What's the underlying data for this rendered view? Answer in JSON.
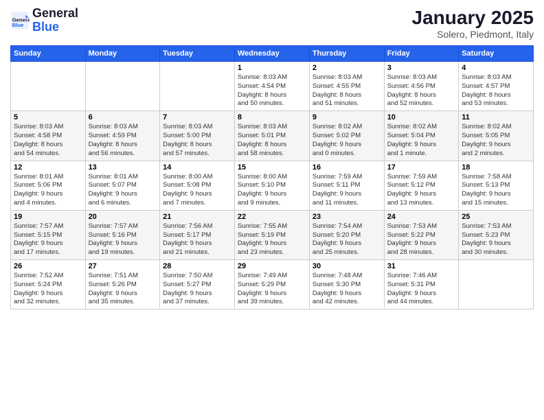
{
  "header": {
    "logo_general": "General",
    "logo_blue": "Blue",
    "month_title": "January 2025",
    "location": "Solero, Piedmont, Italy"
  },
  "weekdays": [
    "Sunday",
    "Monday",
    "Tuesday",
    "Wednesday",
    "Thursday",
    "Friday",
    "Saturday"
  ],
  "weeks": [
    [
      {
        "day": "",
        "info": ""
      },
      {
        "day": "",
        "info": ""
      },
      {
        "day": "",
        "info": ""
      },
      {
        "day": "1",
        "info": "Sunrise: 8:03 AM\nSunset: 4:54 PM\nDaylight: 8 hours\nand 50 minutes."
      },
      {
        "day": "2",
        "info": "Sunrise: 8:03 AM\nSunset: 4:55 PM\nDaylight: 8 hours\nand 51 minutes."
      },
      {
        "day": "3",
        "info": "Sunrise: 8:03 AM\nSunset: 4:56 PM\nDaylight: 8 hours\nand 52 minutes."
      },
      {
        "day": "4",
        "info": "Sunrise: 8:03 AM\nSunset: 4:57 PM\nDaylight: 8 hours\nand 53 minutes."
      }
    ],
    [
      {
        "day": "5",
        "info": "Sunrise: 8:03 AM\nSunset: 4:58 PM\nDaylight: 8 hours\nand 54 minutes."
      },
      {
        "day": "6",
        "info": "Sunrise: 8:03 AM\nSunset: 4:59 PM\nDaylight: 8 hours\nand 56 minutes."
      },
      {
        "day": "7",
        "info": "Sunrise: 8:03 AM\nSunset: 5:00 PM\nDaylight: 8 hours\nand 57 minutes."
      },
      {
        "day": "8",
        "info": "Sunrise: 8:03 AM\nSunset: 5:01 PM\nDaylight: 8 hours\nand 58 minutes."
      },
      {
        "day": "9",
        "info": "Sunrise: 8:02 AM\nSunset: 5:02 PM\nDaylight: 9 hours\nand 0 minutes."
      },
      {
        "day": "10",
        "info": "Sunrise: 8:02 AM\nSunset: 5:04 PM\nDaylight: 9 hours\nand 1 minute."
      },
      {
        "day": "11",
        "info": "Sunrise: 8:02 AM\nSunset: 5:05 PM\nDaylight: 9 hours\nand 2 minutes."
      }
    ],
    [
      {
        "day": "12",
        "info": "Sunrise: 8:01 AM\nSunset: 5:06 PM\nDaylight: 9 hours\nand 4 minutes."
      },
      {
        "day": "13",
        "info": "Sunrise: 8:01 AM\nSunset: 5:07 PM\nDaylight: 9 hours\nand 6 minutes."
      },
      {
        "day": "14",
        "info": "Sunrise: 8:00 AM\nSunset: 5:08 PM\nDaylight: 9 hours\nand 7 minutes."
      },
      {
        "day": "15",
        "info": "Sunrise: 8:00 AM\nSunset: 5:10 PM\nDaylight: 9 hours\nand 9 minutes."
      },
      {
        "day": "16",
        "info": "Sunrise: 7:59 AM\nSunset: 5:11 PM\nDaylight: 9 hours\nand 11 minutes."
      },
      {
        "day": "17",
        "info": "Sunrise: 7:59 AM\nSunset: 5:12 PM\nDaylight: 9 hours\nand 13 minutes."
      },
      {
        "day": "18",
        "info": "Sunrise: 7:58 AM\nSunset: 5:13 PM\nDaylight: 9 hours\nand 15 minutes."
      }
    ],
    [
      {
        "day": "19",
        "info": "Sunrise: 7:57 AM\nSunset: 5:15 PM\nDaylight: 9 hours\nand 17 minutes."
      },
      {
        "day": "20",
        "info": "Sunrise: 7:57 AM\nSunset: 5:16 PM\nDaylight: 9 hours\nand 19 minutes."
      },
      {
        "day": "21",
        "info": "Sunrise: 7:56 AM\nSunset: 5:17 PM\nDaylight: 9 hours\nand 21 minutes."
      },
      {
        "day": "22",
        "info": "Sunrise: 7:55 AM\nSunset: 5:19 PM\nDaylight: 9 hours\nand 23 minutes."
      },
      {
        "day": "23",
        "info": "Sunrise: 7:54 AM\nSunset: 5:20 PM\nDaylight: 9 hours\nand 25 minutes."
      },
      {
        "day": "24",
        "info": "Sunrise: 7:53 AM\nSunset: 5:22 PM\nDaylight: 9 hours\nand 28 minutes."
      },
      {
        "day": "25",
        "info": "Sunrise: 7:53 AM\nSunset: 5:23 PM\nDaylight: 9 hours\nand 30 minutes."
      }
    ],
    [
      {
        "day": "26",
        "info": "Sunrise: 7:52 AM\nSunset: 5:24 PM\nDaylight: 9 hours\nand 32 minutes."
      },
      {
        "day": "27",
        "info": "Sunrise: 7:51 AM\nSunset: 5:26 PM\nDaylight: 9 hours\nand 35 minutes."
      },
      {
        "day": "28",
        "info": "Sunrise: 7:50 AM\nSunset: 5:27 PM\nDaylight: 9 hours\nand 37 minutes."
      },
      {
        "day": "29",
        "info": "Sunrise: 7:49 AM\nSunset: 5:29 PM\nDaylight: 9 hours\nand 39 minutes."
      },
      {
        "day": "30",
        "info": "Sunrise: 7:48 AM\nSunset: 5:30 PM\nDaylight: 9 hours\nand 42 minutes."
      },
      {
        "day": "31",
        "info": "Sunrise: 7:46 AM\nSunset: 5:31 PM\nDaylight: 9 hours\nand 44 minutes."
      },
      {
        "day": "",
        "info": ""
      }
    ]
  ]
}
